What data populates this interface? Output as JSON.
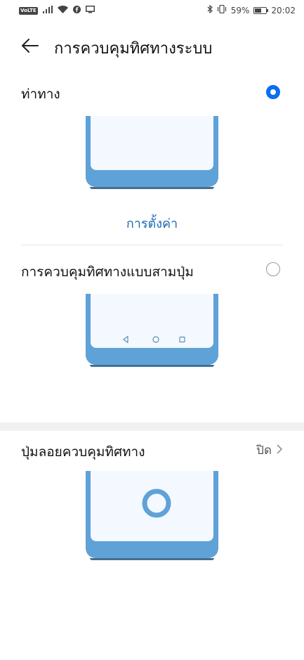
{
  "status_bar": {
    "volte": "VoLTE",
    "battery_percent": "59%",
    "battery_level": 0.59,
    "time": "20:02",
    "icons": [
      "signal-icon",
      "wifi-icon",
      "facebook-icon",
      "screen-icon",
      "bluetooth-icon",
      "vibrate-icon",
      "battery-icon"
    ]
  },
  "header": {
    "title": "การควบคุมทิศทางระบบ"
  },
  "options": [
    {
      "label": "ท่าทาง",
      "selected": true
    },
    {
      "label": "การควบคุมทิศทางแบบสามปุ่ม",
      "selected": false
    }
  ],
  "settings_link": "การตั้งค่า",
  "floating_button": {
    "label": "ปุ่มลอยควบคุมทิศทาง",
    "value": "ปิด"
  },
  "colors": {
    "accent": "#0a6ef0",
    "link": "#1b67b5",
    "illustration": "#5fa2d8"
  }
}
